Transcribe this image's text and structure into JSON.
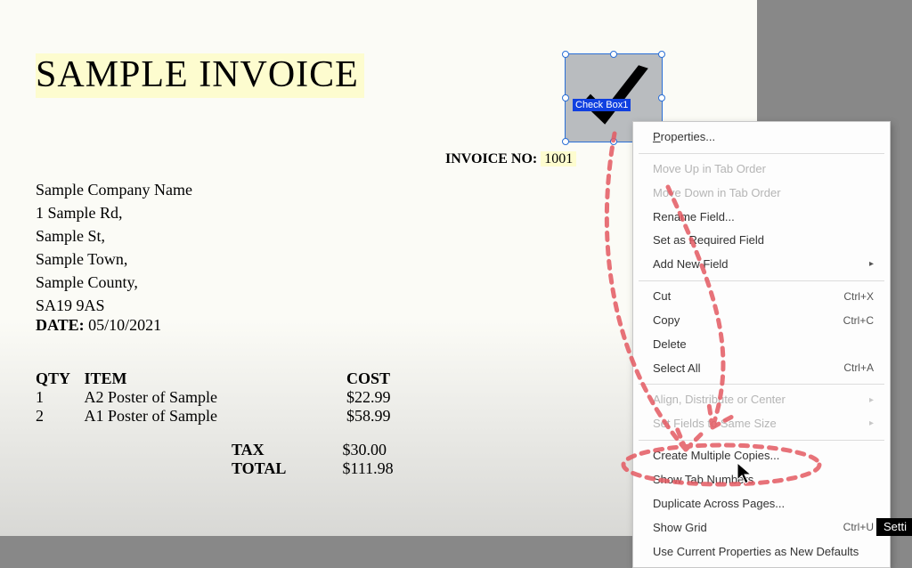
{
  "title": "SAMPLE INVOICE",
  "invoice": {
    "label": "INVOICE NO:",
    "number": "1001"
  },
  "address": {
    "company": "Sample Company Name",
    "line1": "1 Sample Rd,",
    "line2": "Sample St,",
    "town": "Sample Town,",
    "county": "Sample County,",
    "postcode": "SA19 9AS"
  },
  "date": {
    "label": "DATE:",
    "value": "05/10/2021"
  },
  "table": {
    "headers": {
      "qty": "QTY",
      "item": "ITEM",
      "cost": "COST"
    },
    "rows": [
      {
        "qty": "1",
        "item": "A2 Poster of Sample",
        "cost": "$22.99"
      },
      {
        "qty": "2",
        "item": "A1 Poster of Sample",
        "cost": "$58.99"
      }
    ],
    "totals": {
      "tax_label": "TAX",
      "tax_value": "$30.00",
      "total_label": "TOTAL",
      "total_value": "$111.98"
    }
  },
  "form_field": {
    "name_label": "Check Box1"
  },
  "context_menu": {
    "properties": "Properties...",
    "move_up": "Move Up in Tab Order",
    "move_down": "Move Down in Tab Order",
    "rename_field": "Rename Field...",
    "set_required": "Set as Required Field",
    "add_new_field": "Add New Field",
    "cut": "Cut",
    "cut_sc": "Ctrl+X",
    "copy": "Copy",
    "copy_sc": "Ctrl+C",
    "delete": "Delete",
    "select_all": "Select All",
    "select_all_sc": "Ctrl+A",
    "align": "Align, Distribute or Center",
    "same_size": "Set Fields to Same Size",
    "multiple_copies": "Create Multiple Copies...",
    "show_tab_numbers": "Show Tab Numbers",
    "duplicate_pages": "Duplicate Across Pages...",
    "show_grid": "Show Grid",
    "show_grid_sc": "Ctrl+U",
    "use_defaults": "Use Current Properties as New Defaults"
  },
  "corner_tag": "Setti"
}
